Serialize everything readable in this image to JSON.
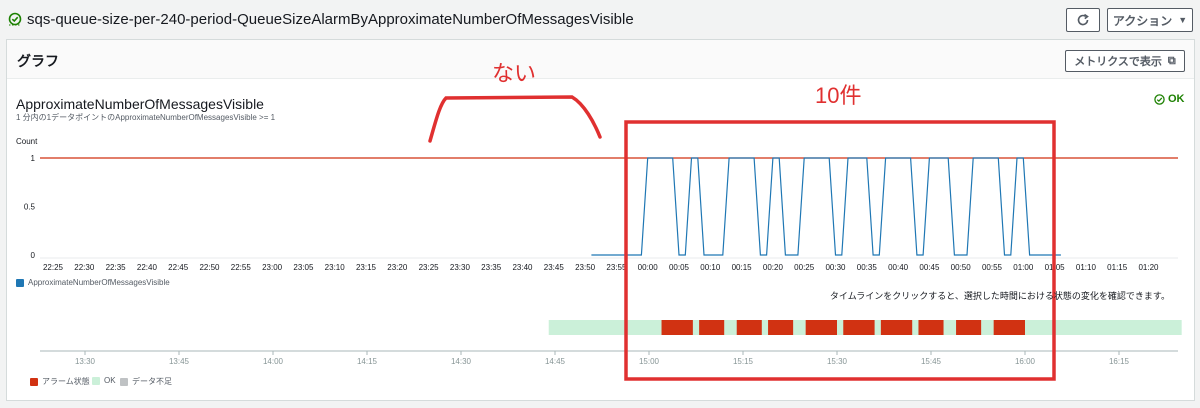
{
  "header": {
    "alarm_name": "sqs-queue-size-per-240-period-QueueSizeAlarmByApproximateNumberOfMessagesVisible",
    "refresh_icon": "refresh-icon",
    "action_label": "アクション"
  },
  "panel": {
    "title": "グラフ",
    "metrics_button": "メトリクスで表示"
  },
  "chart": {
    "title": "ApproximateNumberOfMessagesVisible",
    "subtitle": "1 分内の1データポイントのApproximateNumberOfMessagesVisible >= 1",
    "status": "OK",
    "status_color": "#1d8102"
  },
  "annotations": {
    "none": "ない",
    "ten": "10件",
    "color": "#e03030"
  },
  "chart_data": {
    "type": "line",
    "ylabel": "Count",
    "yticks": [
      "0",
      "0.5",
      "1"
    ],
    "ylim": [
      0,
      1
    ],
    "threshold": 1,
    "threshold_color": "#d13212",
    "series_color": "#1f77b4",
    "xticks": [
      "22:25",
      "22:30",
      "22:35",
      "22:40",
      "22:45",
      "22:50",
      "22:55",
      "23:00",
      "23:05",
      "23:10",
      "23:15",
      "23:20",
      "23:25",
      "23:30",
      "23:35",
      "23:40",
      "23:45",
      "23:50",
      "23:55",
      "00:00",
      "00:05",
      "00:10",
      "00:15",
      "00:20",
      "00:25",
      "00:30",
      "00:35",
      "00:40",
      "00:45",
      "00:50",
      "00:55",
      "01:00",
      "01:05",
      "01:10",
      "01:15",
      "01:20"
    ],
    "series": [
      {
        "name": "ApproximateNumberOfMessagesVisible",
        "points": [
          [
            "23:51",
            0
          ],
          [
            "23:59",
            0
          ],
          [
            "00:00",
            1
          ],
          [
            "00:04",
            1
          ],
          [
            "00:05",
            0
          ],
          [
            "00:06",
            0
          ],
          [
            "00:07",
            1
          ],
          [
            "00:08",
            1
          ],
          [
            "00:09",
            0
          ],
          [
            "00:12",
            0
          ],
          [
            "00:13",
            1
          ],
          [
            "00:17",
            1
          ],
          [
            "00:18",
            0
          ],
          [
            "00:19",
            0
          ],
          [
            "00:20",
            1
          ],
          [
            "00:21",
            1
          ],
          [
            "00:22",
            0
          ],
          [
            "00:24",
            0
          ],
          [
            "00:25",
            1
          ],
          [
            "00:29",
            1
          ],
          [
            "00:30",
            0
          ],
          [
            "00:31",
            0
          ],
          [
            "00:32",
            1
          ],
          [
            "00:35",
            1
          ],
          [
            "00:36",
            0
          ],
          [
            "00:37",
            0
          ],
          [
            "00:38",
            1
          ],
          [
            "00:42",
            1
          ],
          [
            "00:43",
            0
          ],
          [
            "00:44",
            0
          ],
          [
            "00:45",
            1
          ],
          [
            "00:48",
            1
          ],
          [
            "00:49",
            0
          ],
          [
            "00:51",
            0
          ],
          [
            "00:52",
            1
          ],
          [
            "00:56",
            1
          ],
          [
            "00:57",
            0
          ],
          [
            "00:58",
            0
          ],
          [
            "00:59",
            1
          ],
          [
            "01:00",
            1
          ],
          [
            "01:01",
            0
          ],
          [
            "01:06",
            0
          ]
        ]
      }
    ],
    "legend": [
      "ApproximateNumberOfMessagesVisible"
    ]
  },
  "timeline": {
    "note": "タイムラインをクリックすると、選択した時間における状態の変化を確認できます。",
    "xticks": [
      "13:30",
      "13:45",
      "14:00",
      "14:15",
      "14:30",
      "14:45",
      "15:00",
      "15:15",
      "15:30",
      "15:45",
      "16:00",
      "16:15"
    ],
    "ok_color": "#cbf0d9",
    "alarm_color": "#d13212",
    "nodata_color": "#bfc2c4",
    "ok_range": [
      "14:44",
      "16:25"
    ],
    "alarm_ranges": [
      [
        "15:02",
        "15:07"
      ],
      [
        "15:08",
        "15:12"
      ],
      [
        "15:14",
        "15:18"
      ],
      [
        "15:19",
        "15:23"
      ],
      [
        "15:25",
        "15:30"
      ],
      [
        "15:31",
        "15:36"
      ],
      [
        "15:37",
        "15:42"
      ],
      [
        "15:43",
        "15:47"
      ],
      [
        "15:49",
        "15:53"
      ],
      [
        "15:55",
        "16:00"
      ]
    ],
    "legend": {
      "alarm": "アラーム状態",
      "ok": "OK",
      "nodata": "データ不足"
    }
  }
}
